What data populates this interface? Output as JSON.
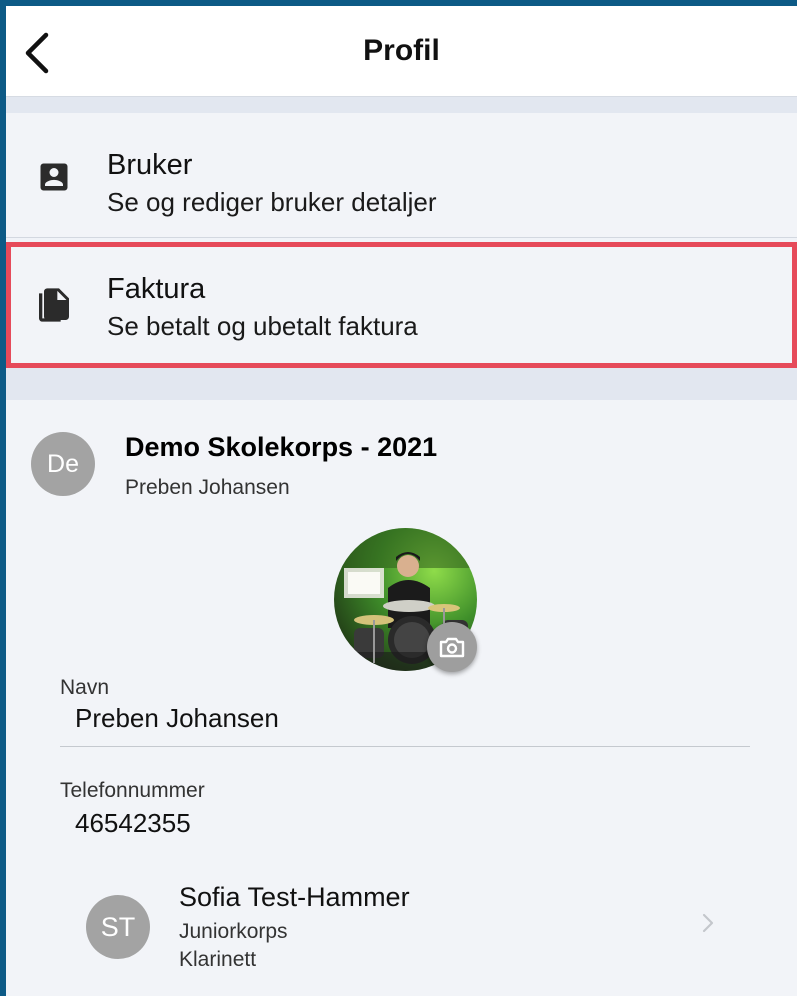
{
  "header": {
    "title": "Profil",
    "back_icon": "chevron-left-icon"
  },
  "menu": [
    {
      "title": "Bruker",
      "subtitle": "Se og rediger bruker detaljer",
      "icon": "account-box-icon"
    },
    {
      "title": "Faktura",
      "subtitle": "Se betalt og ubetalt faktura",
      "icon": "documents-icon",
      "highlighted": true
    }
  ],
  "organization": {
    "avatar_initials": "De",
    "name": "Demo Skolekorps - 2021",
    "user": "Preben Johansen"
  },
  "profile": {
    "photo_icon": "profile-photo",
    "camera_icon": "camera-icon",
    "fields": [
      {
        "label": "Navn",
        "value": "Preben Johansen"
      },
      {
        "label": "Telefonnummer",
        "value": "46542355"
      }
    ]
  },
  "members": [
    {
      "initials": "ST",
      "name": "Sofia Test-Hammer",
      "group": "Juniorkorps",
      "instrument": "Klarinett"
    }
  ],
  "colors": {
    "frame": "#0d5a86",
    "background": "#f0f3f8",
    "highlight": "#e64a5a",
    "avatar": "#a3a3a3"
  }
}
